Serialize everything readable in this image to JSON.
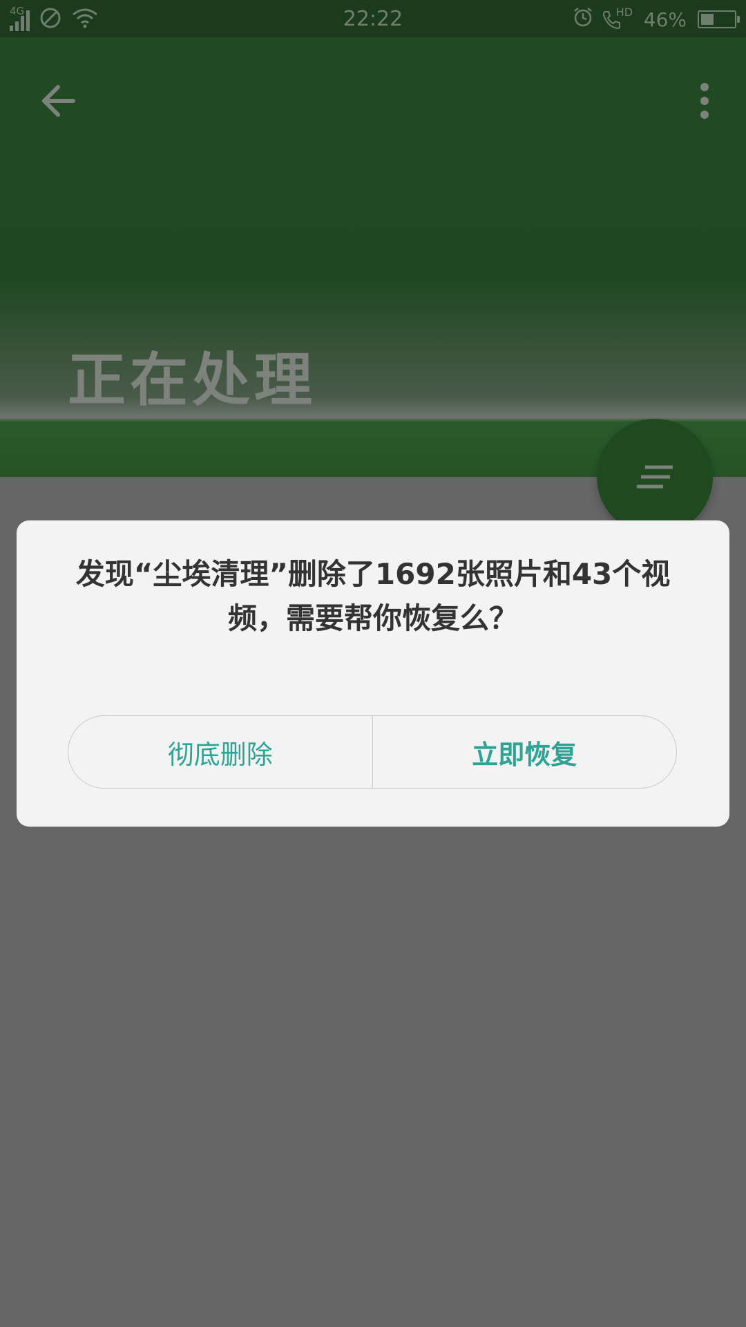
{
  "status_bar": {
    "network": "4G",
    "time": "22:22",
    "call_badge": "HD",
    "battery_percent": "46%",
    "battery_level": 0.46,
    "icons": [
      "signal-icon",
      "no-disturb-icon",
      "wifi-icon",
      "alarm-icon",
      "hd-call-icon",
      "battery-icon"
    ]
  },
  "header": {
    "title": "正在处理",
    "back_icon": "arrow-left-icon",
    "menu_icon": "more-vertical-icon",
    "fab_icon": "sort-lines-icon",
    "colors": {
      "header_bg": "#214a22",
      "fab_bg": "#1f4a20"
    }
  },
  "dialog": {
    "message": "发现“尘埃清理”删除了1692张照片和43个视频，需要帮你恢复么？",
    "secondary_button": "彻底删除",
    "primary_button": "立即恢复",
    "colors": {
      "button_text": "#2ba494",
      "message_text": "#333333",
      "dialog_bg": "#f3f3f4"
    }
  },
  "overlay": {
    "scrim_color": "#666666"
  }
}
